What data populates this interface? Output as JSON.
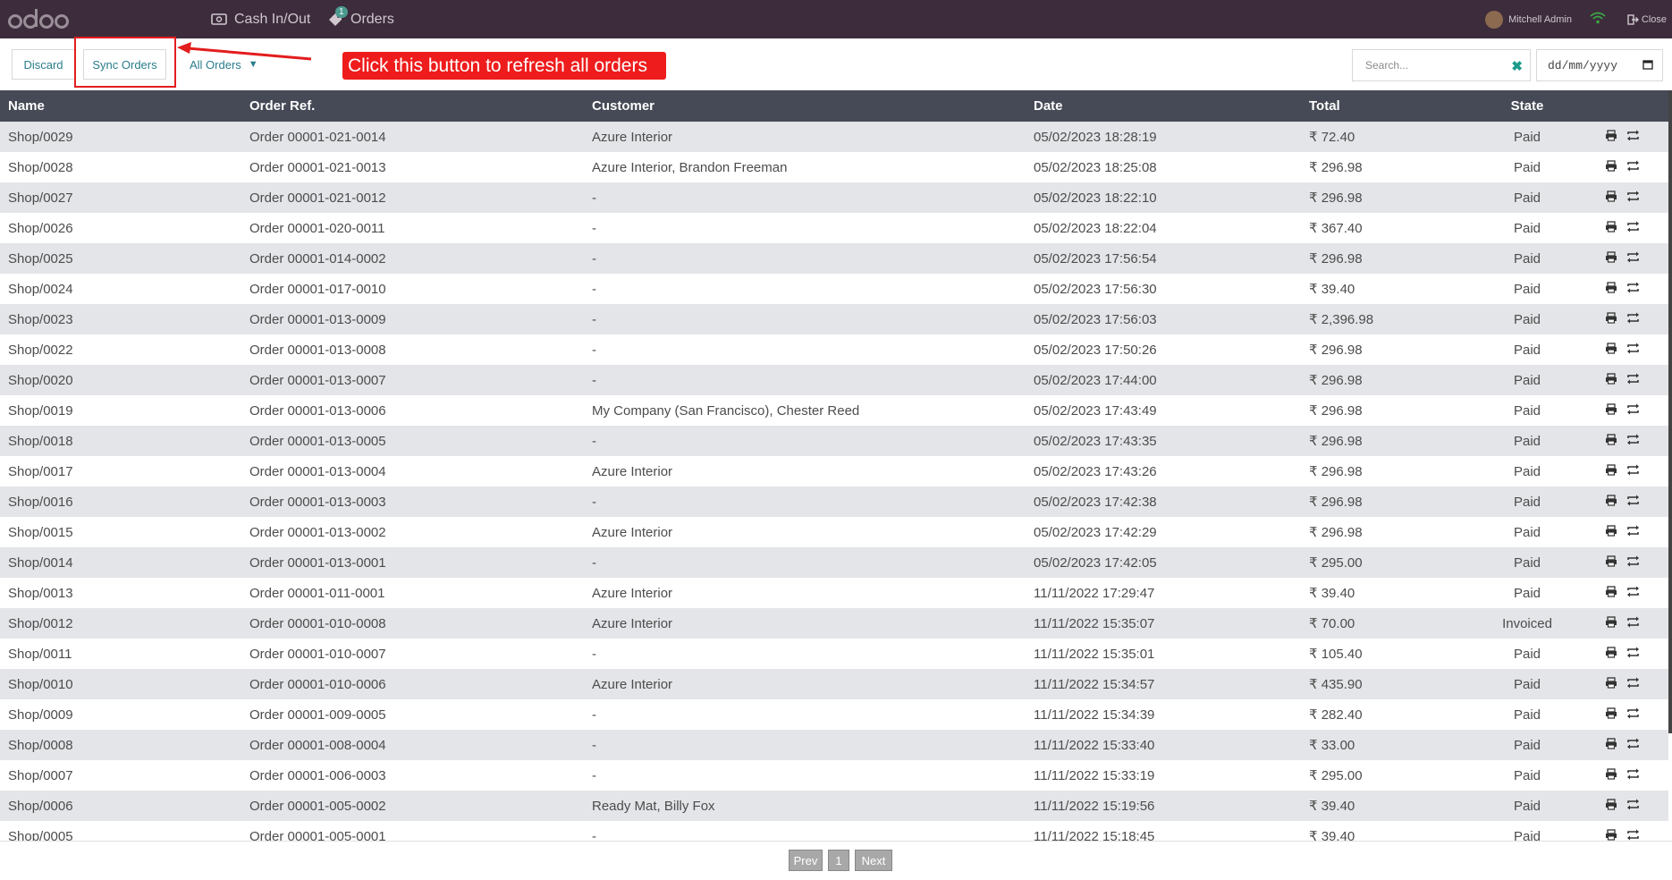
{
  "topbar": {
    "logo": "odoo",
    "nav": [
      {
        "label": "Cash In/Out",
        "icon": "cash-icon"
      },
      {
        "label": "Orders",
        "icon": "tag-icon",
        "badge": "1"
      }
    ],
    "user": "Mitchell Admin",
    "close_label": "Close"
  },
  "controls": {
    "discard_label": "Discard",
    "sync_label": "Sync Orders",
    "filter_value": "All Orders",
    "callout_text": "Click this button to refresh all orders",
    "search_placeholder": "Search...",
    "date_placeholder": "dd/mm/yyyy"
  },
  "table": {
    "headers": [
      "Name",
      "Order Ref.",
      "Customer",
      "Date",
      "Total",
      "State"
    ],
    "rows": [
      {
        "name": "Shop/0029",
        "ref": "Order 00001-021-0014",
        "customer": "Azure Interior",
        "date": "05/02/2023 18:28:19",
        "total": "₹ 72.40",
        "state": "Paid"
      },
      {
        "name": "Shop/0028",
        "ref": "Order 00001-021-0013",
        "customer": "Azure Interior, Brandon Freeman",
        "date": "05/02/2023 18:25:08",
        "total": "₹ 296.98",
        "state": "Paid"
      },
      {
        "name": "Shop/0027",
        "ref": "Order 00001-021-0012",
        "customer": "-",
        "date": "05/02/2023 18:22:10",
        "total": "₹ 296.98",
        "state": "Paid"
      },
      {
        "name": "Shop/0026",
        "ref": "Order 00001-020-0011",
        "customer": "-",
        "date": "05/02/2023 18:22:04",
        "total": "₹ 367.40",
        "state": "Paid"
      },
      {
        "name": "Shop/0025",
        "ref": "Order 00001-014-0002",
        "customer": "-",
        "date": "05/02/2023 17:56:54",
        "total": "₹ 296.98",
        "state": "Paid"
      },
      {
        "name": "Shop/0024",
        "ref": "Order 00001-017-0010",
        "customer": "-",
        "date": "05/02/2023 17:56:30",
        "total": "₹ 39.40",
        "state": "Paid"
      },
      {
        "name": "Shop/0023",
        "ref": "Order 00001-013-0009",
        "customer": "-",
        "date": "05/02/2023 17:56:03",
        "total": "₹ 2,396.98",
        "state": "Paid"
      },
      {
        "name": "Shop/0022",
        "ref": "Order 00001-013-0008",
        "customer": "-",
        "date": "05/02/2023 17:50:26",
        "total": "₹ 296.98",
        "state": "Paid"
      },
      {
        "name": "Shop/0020",
        "ref": "Order 00001-013-0007",
        "customer": "-",
        "date": "05/02/2023 17:44:00",
        "total": "₹ 296.98",
        "state": "Paid"
      },
      {
        "name": "Shop/0019",
        "ref": "Order 00001-013-0006",
        "customer": "My Company (San Francisco), Chester Reed",
        "date": "05/02/2023 17:43:49",
        "total": "₹ 296.98",
        "state": "Paid"
      },
      {
        "name": "Shop/0018",
        "ref": "Order 00001-013-0005",
        "customer": "-",
        "date": "05/02/2023 17:43:35",
        "total": "₹ 296.98",
        "state": "Paid"
      },
      {
        "name": "Shop/0017",
        "ref": "Order 00001-013-0004",
        "customer": "Azure Interior",
        "date": "05/02/2023 17:43:26",
        "total": "₹ 296.98",
        "state": "Paid"
      },
      {
        "name": "Shop/0016",
        "ref": "Order 00001-013-0003",
        "customer": "-",
        "date": "05/02/2023 17:42:38",
        "total": "₹ 296.98",
        "state": "Paid"
      },
      {
        "name": "Shop/0015",
        "ref": "Order 00001-013-0002",
        "customer": "Azure Interior",
        "date": "05/02/2023 17:42:29",
        "total": "₹ 296.98",
        "state": "Paid"
      },
      {
        "name": "Shop/0014",
        "ref": "Order 00001-013-0001",
        "customer": "-",
        "date": "05/02/2023 17:42:05",
        "total": "₹ 295.00",
        "state": "Paid"
      },
      {
        "name": "Shop/0013",
        "ref": "Order 00001-011-0001",
        "customer": "Azure Interior",
        "date": "11/11/2022 17:29:47",
        "total": "₹ 39.40",
        "state": "Paid"
      },
      {
        "name": "Shop/0012",
        "ref": "Order 00001-010-0008",
        "customer": "Azure Interior",
        "date": "11/11/2022 15:35:07",
        "total": "₹ 70.00",
        "state": "Invoiced"
      },
      {
        "name": "Shop/0011",
        "ref": "Order 00001-010-0007",
        "customer": "-",
        "date": "11/11/2022 15:35:01",
        "total": "₹ 105.40",
        "state": "Paid"
      },
      {
        "name": "Shop/0010",
        "ref": "Order 00001-010-0006",
        "customer": "Azure Interior",
        "date": "11/11/2022 15:34:57",
        "total": "₹ 435.90",
        "state": "Paid"
      },
      {
        "name": "Shop/0009",
        "ref": "Order 00001-009-0005",
        "customer": "-",
        "date": "11/11/2022 15:34:39",
        "total": "₹ 282.40",
        "state": "Paid"
      },
      {
        "name": "Shop/0008",
        "ref": "Order 00001-008-0004",
        "customer": "-",
        "date": "11/11/2022 15:33:40",
        "total": "₹ 33.00",
        "state": "Paid"
      },
      {
        "name": "Shop/0007",
        "ref": "Order 00001-006-0003",
        "customer": "-",
        "date": "11/11/2022 15:33:19",
        "total": "₹ 295.00",
        "state": "Paid"
      },
      {
        "name": "Shop/0006",
        "ref": "Order 00001-005-0002",
        "customer": "Ready Mat, Billy Fox",
        "date": "11/11/2022 15:19:56",
        "total": "₹ 39.40",
        "state": "Paid"
      },
      {
        "name": "Shop/0005",
        "ref": "Order 00001-005-0001",
        "customer": "-",
        "date": "11/11/2022 15:18:45",
        "total": "₹ 39.40",
        "state": "Paid"
      }
    ],
    "row_actions": [
      "print-icon",
      "refund-icon"
    ]
  },
  "pager": {
    "prev_label": "Prev",
    "page": "1",
    "next_label": "Next"
  },
  "colors": {
    "topbar": "#3d2c3c",
    "header": "#464a56",
    "accent": "#2a7d8c",
    "callout": "#ee1c1c"
  }
}
